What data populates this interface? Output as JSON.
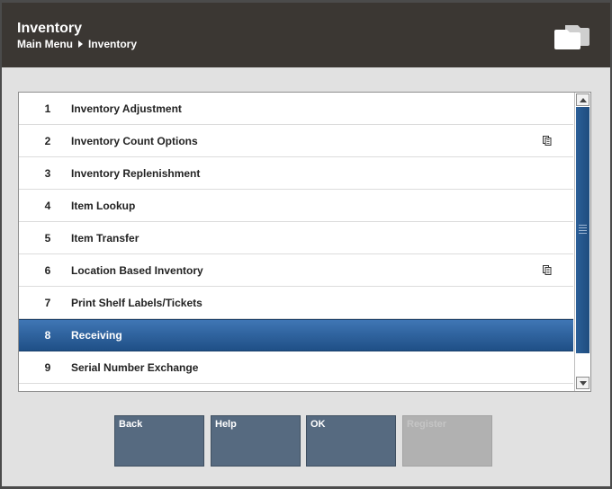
{
  "header": {
    "title": "Inventory",
    "breadcrumb": [
      "Main Menu",
      "Inventory"
    ]
  },
  "menu": {
    "items": [
      {
        "num": "1",
        "label": "Inventory Adjustment",
        "has_submenu": false
      },
      {
        "num": "2",
        "label": "Inventory Count Options",
        "has_submenu": true
      },
      {
        "num": "3",
        "label": "Inventory Replenishment",
        "has_submenu": false
      },
      {
        "num": "4",
        "label": "Item Lookup",
        "has_submenu": false
      },
      {
        "num": "5",
        "label": "Item Transfer",
        "has_submenu": false
      },
      {
        "num": "6",
        "label": "Location Based Inventory",
        "has_submenu": true
      },
      {
        "num": "7",
        "label": "Print Shelf Labels/Tickets",
        "has_submenu": false
      },
      {
        "num": "8",
        "label": "Receiving",
        "has_submenu": false
      },
      {
        "num": "9",
        "label": "Serial Number Exchange",
        "has_submenu": false
      }
    ],
    "selected": "8"
  },
  "buttons": {
    "back": "Back",
    "help": "Help",
    "ok": "OK",
    "register": "Register"
  },
  "colors": {
    "header_bg": "#3b3733",
    "selection": "#2d6099",
    "button": "#566a80",
    "button_disabled": "#b1b1b1"
  },
  "icons": {
    "header": "camera-icon",
    "submenu": "submenu-icon"
  }
}
